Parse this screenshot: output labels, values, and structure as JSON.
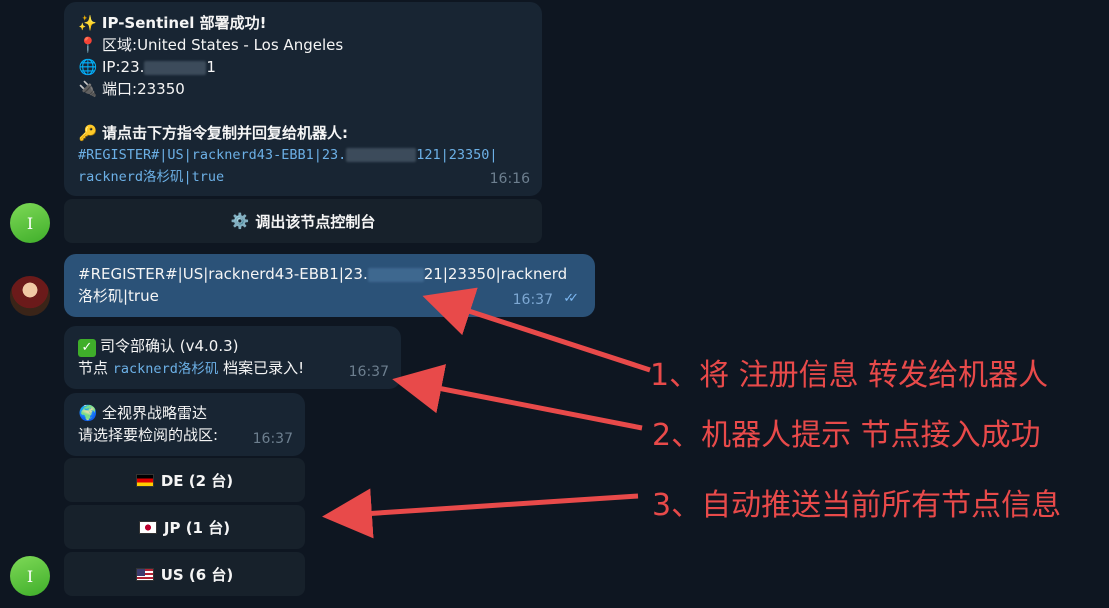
{
  "msg1": {
    "title": "✨ IP-Sentinel 部署成功!",
    "region_label": "区域:",
    "region_value": "United States - Los Angeles",
    "ip_label": "IP:",
    "ip_prefix": "23.",
    "ip_suffix": "1",
    "port_label": "端口:",
    "port_value": "23350",
    "instruction": "请点击下方指令复制并回复给机器人:",
    "code_line1_a": "#REGISTER#|US|racknerd43-EBB1|23.",
    "code_line1_b": "121|23350|",
    "code_line2": "racknerd洛杉矶|true",
    "time": "16:16",
    "button_label": "调出该节点控制台"
  },
  "msg2": {
    "line1_a": "#REGISTER#|US|racknerd43-EBB1|23.",
    "line1_b": "21|23350|racknerd",
    "line2": "洛杉矶|true",
    "time": "16:37"
  },
  "msg3": {
    "title": "司令部确认 (v4.0.3)",
    "line2_a": "节点",
    "line2_code": "racknerd洛杉矶",
    "line2_b": "档案已录入!",
    "time": "16:37"
  },
  "msg4": {
    "title": "全视界战略雷达",
    "line2": "请选择要检阅的战区:",
    "time": "16:37",
    "buttons": [
      {
        "label": "DE (2 台)",
        "flag": "DE"
      },
      {
        "label": "JP (1 台)",
        "flag": "JP"
      },
      {
        "label": "US (6 台)",
        "flag": "US"
      }
    ]
  },
  "avatars": {
    "bot_letter": "I",
    "bot_color": "#5cc23a"
  },
  "annotations": {
    "a1": "1、将 注册信息 转发给机器人",
    "a2": "2、机器人提示 节点接入成功",
    "a3": "3、自动推送当前所有节点信息",
    "color": "#e84a4a"
  },
  "icons": [
    "sparkles-icon",
    "pin-icon",
    "globe-icon",
    "plug-icon",
    "key-icon",
    "gear-icon",
    "check-icon",
    "earth-icon",
    "double-check-icon"
  ]
}
